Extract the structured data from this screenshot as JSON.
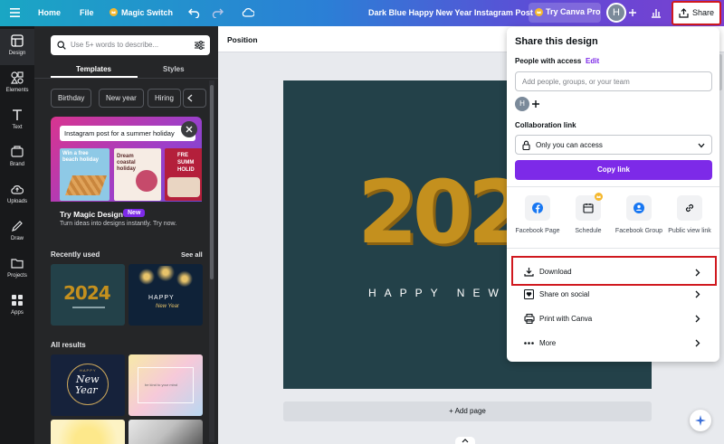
{
  "topbar": {
    "home": "Home",
    "file": "File",
    "magic_switch": "Magic Switch",
    "doc_title": "Dark Blue Happy New Year Instagram Post",
    "try_pro": "Try Canva Pro",
    "avatar": "H",
    "share": "Share"
  },
  "rail": {
    "items": [
      {
        "label": "Design",
        "icon": "design-icon"
      },
      {
        "label": "Elements",
        "icon": "elements-icon"
      },
      {
        "label": "Text",
        "icon": "text-icon"
      },
      {
        "label": "Brand",
        "icon": "brand-icon"
      },
      {
        "label": "Uploads",
        "icon": "uploads-icon"
      },
      {
        "label": "Draw",
        "icon": "draw-icon"
      },
      {
        "label": "Projects",
        "icon": "projects-icon"
      },
      {
        "label": "Apps",
        "icon": "apps-icon"
      }
    ]
  },
  "panel": {
    "search_placeholder": "Use 5+ words to describe...",
    "tabs": [
      "Templates",
      "Styles"
    ],
    "chips": [
      "Birthday",
      "New year",
      "Hiring"
    ],
    "promo": {
      "prompt": "Instagram post for a summer holiday",
      "card1": "Win a free beach holiday",
      "card2": "Dream coastal holiday",
      "card3": "FRE SUMM HOLID",
      "title": "Try Magic Design",
      "badge": "New",
      "desc": "Turn ideas into designs instantly. Try now."
    },
    "recently_used": "Recently used",
    "see_all": "See all",
    "thumb_2024": "2024",
    "thumb_happy": "HAPPY",
    "thumb_newyear": "New Year",
    "all_results": "All results",
    "result_happy": "HAPPY",
    "result_new": "New",
    "result_year": "Year",
    "result_text": "be kind to your mind"
  },
  "editor": {
    "position": "Position",
    "design_year": "202",
    "design_tagline": "HAPPY NEW",
    "add_page": "+ Add page"
  },
  "share_panel": {
    "title": "Share this design",
    "people_label": "People with access",
    "edit": "Edit",
    "add_placeholder": "Add people, groups, or your team",
    "avatar": "H",
    "collab_label": "Collaboration link",
    "access": "Only you can access",
    "copy_link": "Copy link",
    "options": [
      {
        "label": "Facebook Page",
        "icon": "facebook-icon"
      },
      {
        "label": "Schedule",
        "icon": "calendar-icon"
      },
      {
        "label": "Facebook Group",
        "icon": "facebook-group-icon"
      },
      {
        "label": "Public view link",
        "icon": "link-icon"
      }
    ],
    "menu": [
      {
        "label": "Download",
        "icon": "download-icon"
      },
      {
        "label": "Share on social",
        "icon": "heart-icon"
      },
      {
        "label": "Print with Canva",
        "icon": "print-icon"
      },
      {
        "label": "More",
        "icon": "more-icon"
      }
    ]
  },
  "colors": {
    "accent": "#7d2ae8",
    "highlight": "#d0191f",
    "design_bg": "#234149",
    "gold": "#c4901e"
  }
}
